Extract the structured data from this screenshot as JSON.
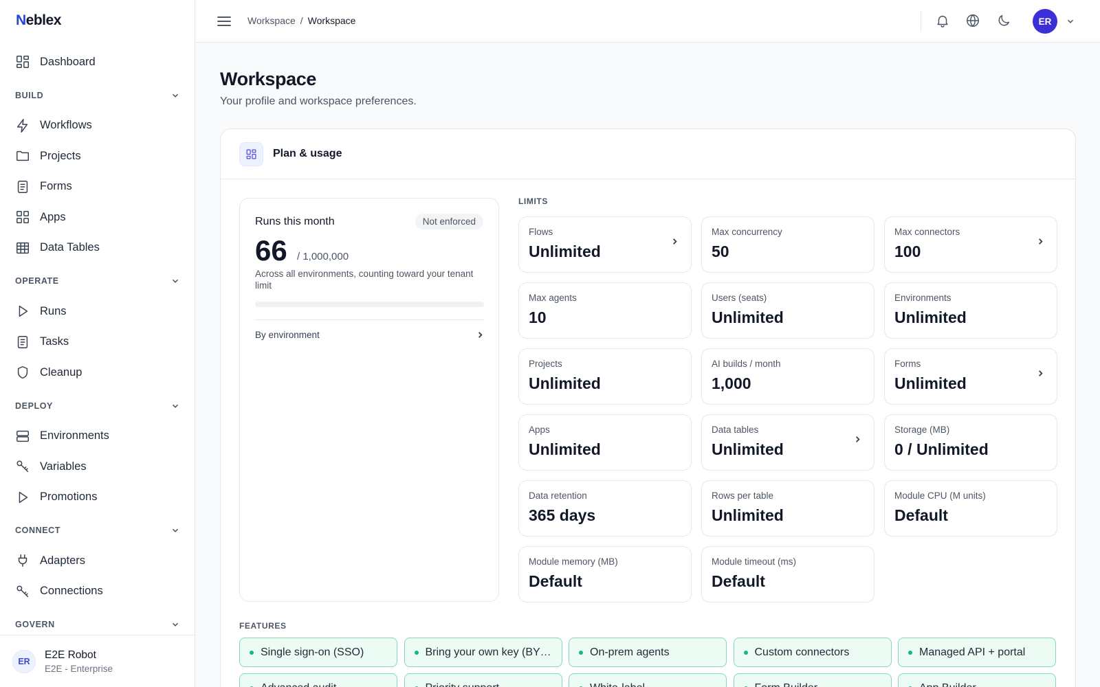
{
  "app": {
    "logo_first": "N",
    "logo_rest": "eblex"
  },
  "sidebar": {
    "dashboard": "Dashboard",
    "sections": {
      "build": "BUILD",
      "operate": "OPERATE",
      "deploy": "DEPLOY",
      "connect": "CONNECT",
      "govern": "GOVERN"
    },
    "build_items": [
      "Workflows",
      "Projects",
      "Forms",
      "Apps",
      "Data Tables"
    ],
    "operate_items": [
      "Runs",
      "Tasks",
      "Cleanup"
    ],
    "deploy_items": [
      "Environments",
      "Variables",
      "Promotions"
    ],
    "connect_items": [
      "Adapters",
      "Connections"
    ],
    "user": {
      "initials": "ER",
      "name": "E2E Robot",
      "org": "E2E - Enterprise"
    }
  },
  "topbar": {
    "breadcrumb": [
      "Workspace",
      "/",
      "Workspace"
    ],
    "avatar_initials": "ER",
    "icons": [
      "bell-icon",
      "globe-icon",
      "moon-icon"
    ]
  },
  "page": {
    "title": "Workspace",
    "subtitle": "Your profile and workspace preferences."
  },
  "plan": {
    "title": "Plan & usage",
    "runs": {
      "title": "Runs this month",
      "badge": "Not enforced",
      "count": "66",
      "total": "/ 1,000,000",
      "progress_fraction": 6.6e-05,
      "description": "Across all environments, counting toward your tenant limit",
      "by_env": "By environment"
    },
    "limits_label": "LIMITS",
    "limits": [
      {
        "label": "Flows",
        "value": "Unlimited",
        "link": true
      },
      {
        "label": "Max concurrency",
        "value": "50",
        "link": false
      },
      {
        "label": "Max connectors",
        "value": "100",
        "link": true
      },
      {
        "label": "Max agents",
        "value": "10",
        "link": false
      },
      {
        "label": "Users (seats)",
        "value": "Unlimited",
        "link": false
      },
      {
        "label": "Environments",
        "value": "Unlimited",
        "link": false
      },
      {
        "label": "Projects",
        "value": "Unlimited",
        "link": false
      },
      {
        "label": "AI builds / month",
        "value": "1,000",
        "link": false
      },
      {
        "label": "Forms",
        "value": "Unlimited",
        "link": true
      },
      {
        "label": "Apps",
        "value": "Unlimited",
        "link": false
      },
      {
        "label": "Data tables",
        "value": "Unlimited",
        "link": true
      },
      {
        "label": "Storage (MB)",
        "value": "0 / Unlimited",
        "link": false
      },
      {
        "label": "Data retention",
        "value": "365 days",
        "link": false
      },
      {
        "label": "Rows per table",
        "value": "Unlimited",
        "link": false
      },
      {
        "label": "Module CPU (M units)",
        "value": "Default",
        "link": false
      },
      {
        "label": "Module memory (MB)",
        "value": "Default",
        "link": false
      },
      {
        "label": "Module timeout (ms)",
        "value": "Default",
        "link": false
      }
    ],
    "features_label": "FEATURES",
    "features": [
      "Single sign-on (SSO)",
      "Bring your own key (BY…",
      "On-prem agents",
      "Custom connectors",
      "Managed API + portal",
      "Advanced audit",
      "Priority support",
      "White-label",
      "Form Builder",
      "App Builder"
    ],
    "colors": {
      "feature_bg": "#ecfbf3",
      "feature_border": "#86d9b4",
      "feature_dot": "#10b981",
      "accent": "#3b30d6"
    }
  }
}
